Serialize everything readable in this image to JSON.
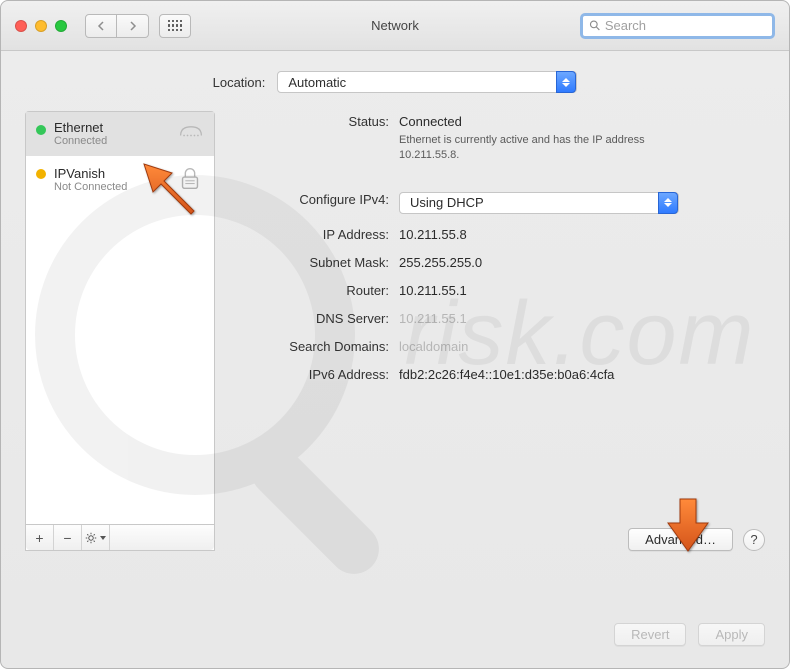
{
  "window": {
    "title": "Network",
    "search_placeholder": "Search"
  },
  "location": {
    "label": "Location:",
    "value": "Automatic"
  },
  "sidebar": {
    "items": [
      {
        "name": "Ethernet",
        "sub": "Connected",
        "status": "green",
        "icon": "ethernet"
      },
      {
        "name": "IPVanish",
        "sub": "Not Connected",
        "status": "amber",
        "icon": "lock"
      }
    ],
    "footer": {
      "add": "+",
      "remove": "−"
    }
  },
  "detail": {
    "status_label": "Status:",
    "status_value": "Connected",
    "status_desc": "Ethernet is currently active and has the IP address 10.211.55.8.",
    "configure_label": "Configure IPv4:",
    "configure_value": "Using DHCP",
    "ip_label": "IP Address:",
    "ip_value": "10.211.55.8",
    "subnet_label": "Subnet Mask:",
    "subnet_value": "255.255.255.0",
    "router_label": "Router:",
    "router_value": "10.211.55.1",
    "dns_label": "DNS Server:",
    "dns_value": "10.211.55.1",
    "search_domains_label": "Search Domains:",
    "search_domains_value": "localdomain",
    "ipv6_label": "IPv6 Address:",
    "ipv6_value": "fdb2:2c26:f4e4::10e1:d35e:b0a6:4cfa",
    "advanced_label": "Advanced…",
    "help_label": "?"
  },
  "footer": {
    "revert": "Revert",
    "apply": "Apply"
  },
  "colors": {
    "accent_blue": "#2f7bff",
    "status_green": "#34c759",
    "status_amber": "#f2b200",
    "arrow_orange": "#e86a1f"
  },
  "watermark": {
    "text": "risk.com"
  }
}
